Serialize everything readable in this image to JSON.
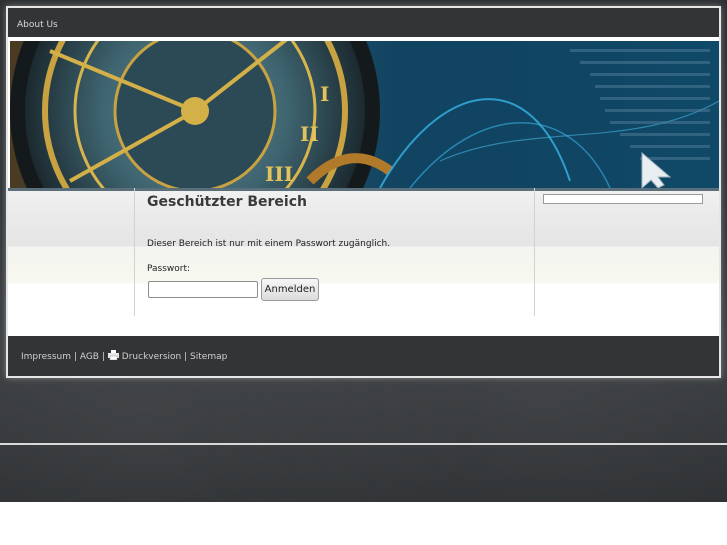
{
  "nav": {
    "items": [
      {
        "label": "About Us"
      }
    ]
  },
  "main": {
    "title": "Geschützter Bereich",
    "info_text": "Dieser Bereich ist nur mit einem Passwort zugänglich.",
    "password_label": "Passwort:",
    "password_value": "",
    "login_label": "Anmelden"
  },
  "footer": {
    "impressum": "Impressum",
    "agb": "AGB",
    "print": "Druckversion",
    "sitemap": "Sitemap",
    "separator": "|"
  },
  "icons": {
    "print": "printer-icon"
  },
  "colors": {
    "nav_bg": "#333436",
    "footer_bg": "#333436",
    "title": "#3a3a3a",
    "backdrop": "#34373a"
  }
}
